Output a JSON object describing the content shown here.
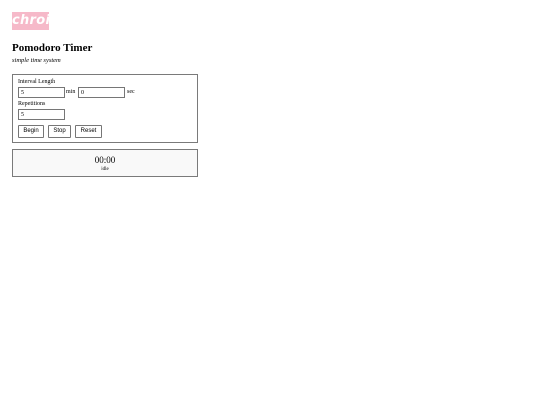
{
  "brand": {
    "logo_text": "chroi",
    "logo_color": "#f6b9c9"
  },
  "header": {
    "title": "Pomodoro Timer",
    "subtitle": "simple time system"
  },
  "settings": {
    "interval_label": "Interval Length",
    "minutes_value": "5",
    "minutes_unit": "min",
    "seconds_value": "0",
    "seconds_unit": "sec",
    "repetitions_label": "Repetitions",
    "repetitions_value": "5"
  },
  "controls": {
    "begin_label": "Begin",
    "stop_label": "Stop",
    "reset_label": "Reset"
  },
  "timer": {
    "time": "00:00",
    "state": "idle"
  }
}
